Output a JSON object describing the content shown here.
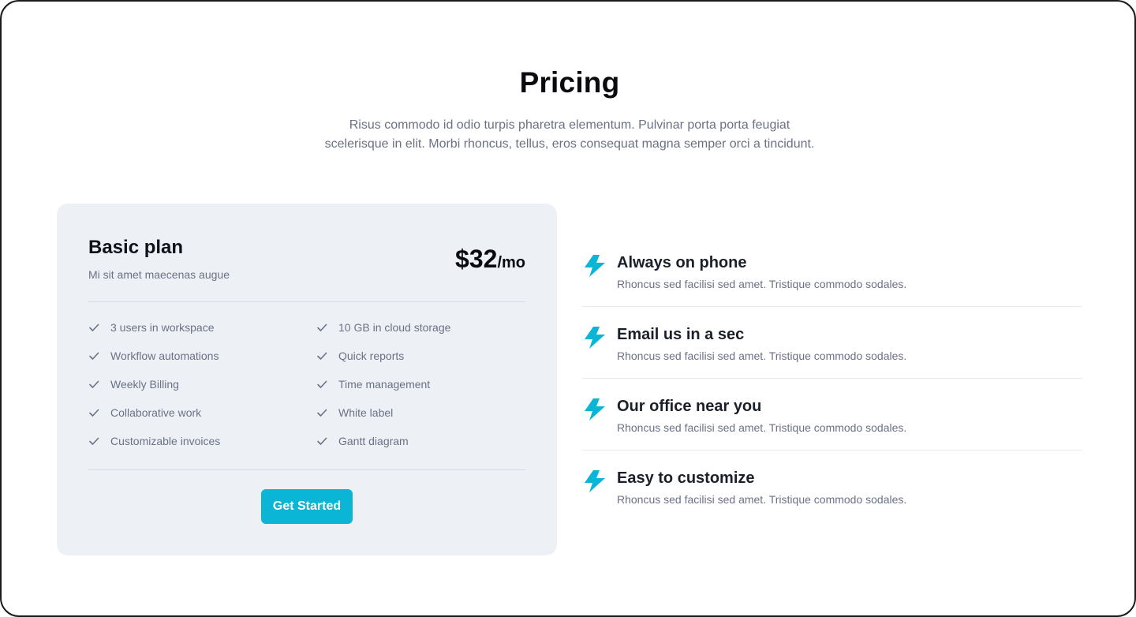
{
  "header": {
    "title": "Pricing",
    "subtitle": "Risus commodo id odio turpis pharetra elementum. Pulvinar porta porta feugiat scelerisque in elit. Morbi rhoncus, tellus, eros consequat magna semper orci a tincidunt."
  },
  "plan": {
    "name": "Basic plan",
    "description": "Mi sit amet maecenas augue",
    "price": "$32",
    "period": "/mo",
    "features": [
      "3 users in workspace",
      "10 GB in cloud storage",
      "Workflow automations",
      "Quick reports",
      "Weekly Billing",
      "Time management",
      "Collaborative work",
      "White label",
      "Customizable invoices",
      "Gantt diagram"
    ],
    "cta_label": "Get Started"
  },
  "benefits": [
    {
      "title": "Always on phone",
      "description": "Rhoncus sed facilisi sed amet. Tristique commodo sodales.",
      "icon": "lightning-bolt-icon"
    },
    {
      "title": "Email us in a sec",
      "description": "Rhoncus sed facilisi sed amet. Tristique commodo sodales.",
      "icon": "lightning-bolt-icon"
    },
    {
      "title": "Our office near you",
      "description": "Rhoncus sed facilisi sed amet. Tristique commodo sodales.",
      "icon": "lightning-bolt-icon"
    },
    {
      "title": "Easy to customize",
      "description": "Rhoncus sed facilisi sed amet. Tristique commodo sodales.",
      "icon": "lightning-bolt-icon"
    }
  ],
  "colors": {
    "accent": "#0bb5d6",
    "card_background": "#edf1f6",
    "heading": "#0b0b0f",
    "muted_text": "#6b7185"
  }
}
